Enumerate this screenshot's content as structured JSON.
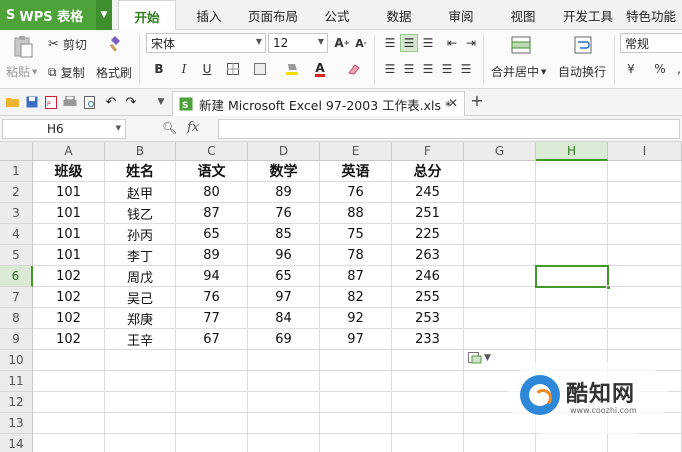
{
  "menubar": {
    "app_label": "WPS 表格",
    "tabs": [
      "开始",
      "插入",
      "页面布局",
      "公式",
      "数据",
      "审阅",
      "视图",
      "开发工具",
      "特色功能"
    ],
    "active_tab": "开始"
  },
  "ribbon": {
    "cut": "剪切",
    "paste": "粘贴",
    "copy": "复制",
    "format_painter": "格式刷",
    "font_name": "宋体",
    "font_size": "12",
    "merge_center": "合并居中",
    "wrap_text": "自动换行",
    "number_format": "常规",
    "percent": "%",
    "comma": ","
  },
  "doc": {
    "tab_title": "新建 Microsoft Excel 97-2003 工作表.xls *"
  },
  "formula_bar": {
    "name_box": "H6",
    "fx": "fx",
    "content": ""
  },
  "sheet": {
    "columns": [
      "A",
      "B",
      "C",
      "D",
      "E",
      "F",
      "G",
      "H",
      "I"
    ],
    "active_column": "H",
    "rows": [
      "1",
      "2",
      "3",
      "4",
      "5",
      "6",
      "7",
      "8",
      "9",
      "10",
      "11",
      "12",
      "13",
      "14"
    ],
    "active_row": "6",
    "header": [
      "班级",
      "姓名",
      "语文",
      "数学",
      "英语",
      "总分"
    ],
    "data": [
      [
        "101",
        "赵甲",
        "80",
        "89",
        "76",
        "245"
      ],
      [
        "101",
        "钱乙",
        "87",
        "76",
        "88",
        "251"
      ],
      [
        "101",
        "孙丙",
        "65",
        "85",
        "75",
        "225"
      ],
      [
        "101",
        "李丁",
        "89",
        "96",
        "78",
        "263"
      ],
      [
        "102",
        "周戊",
        "94",
        "65",
        "87",
        "246"
      ],
      [
        "102",
        "吴己",
        "76",
        "97",
        "82",
        "255"
      ],
      [
        "102",
        "郑庚",
        "77",
        "84",
        "92",
        "253"
      ],
      [
        "102",
        "王辛",
        "67",
        "69",
        "97",
        "233"
      ]
    ],
    "selected_cell": "H6"
  },
  "watermark": {
    "title": "酷知网",
    "url": "www.coozhi.com"
  },
  "colors": {
    "accent": "#4ea23a",
    "active_header": "#dbead5",
    "selection_border": "#3f9a2a"
  }
}
